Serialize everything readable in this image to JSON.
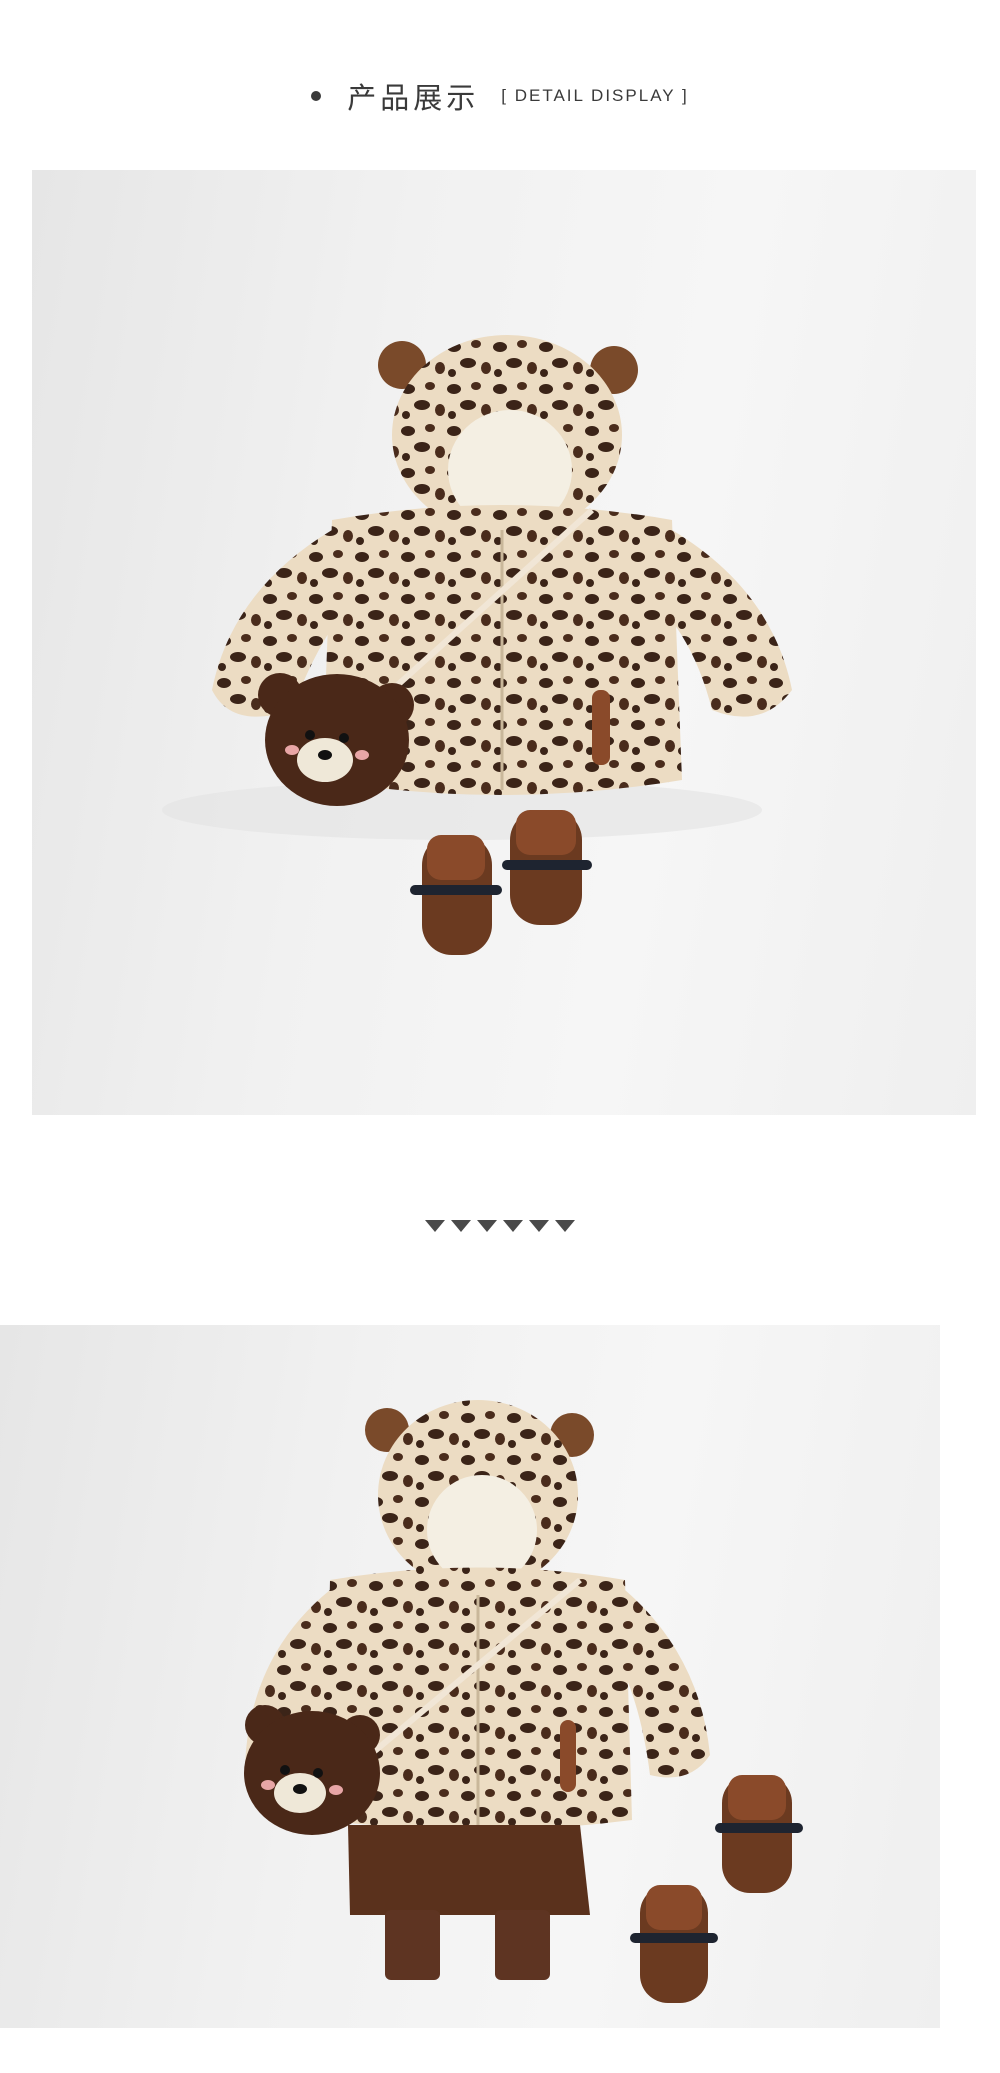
{
  "header": {
    "title_cn": "产品展示",
    "title_en": "[ DETAIL DISPLAY ]"
  },
  "icons": {
    "bullet": "dot-icon",
    "divider": "chevron-down-icon"
  },
  "divider": {
    "count": 6
  },
  "colors": {
    "text": "#3a3a3a",
    "fur": "#ecdcc3",
    "spots": "#3b2418",
    "brown": "#6b3a20",
    "background": "#f2f2f2"
  }
}
